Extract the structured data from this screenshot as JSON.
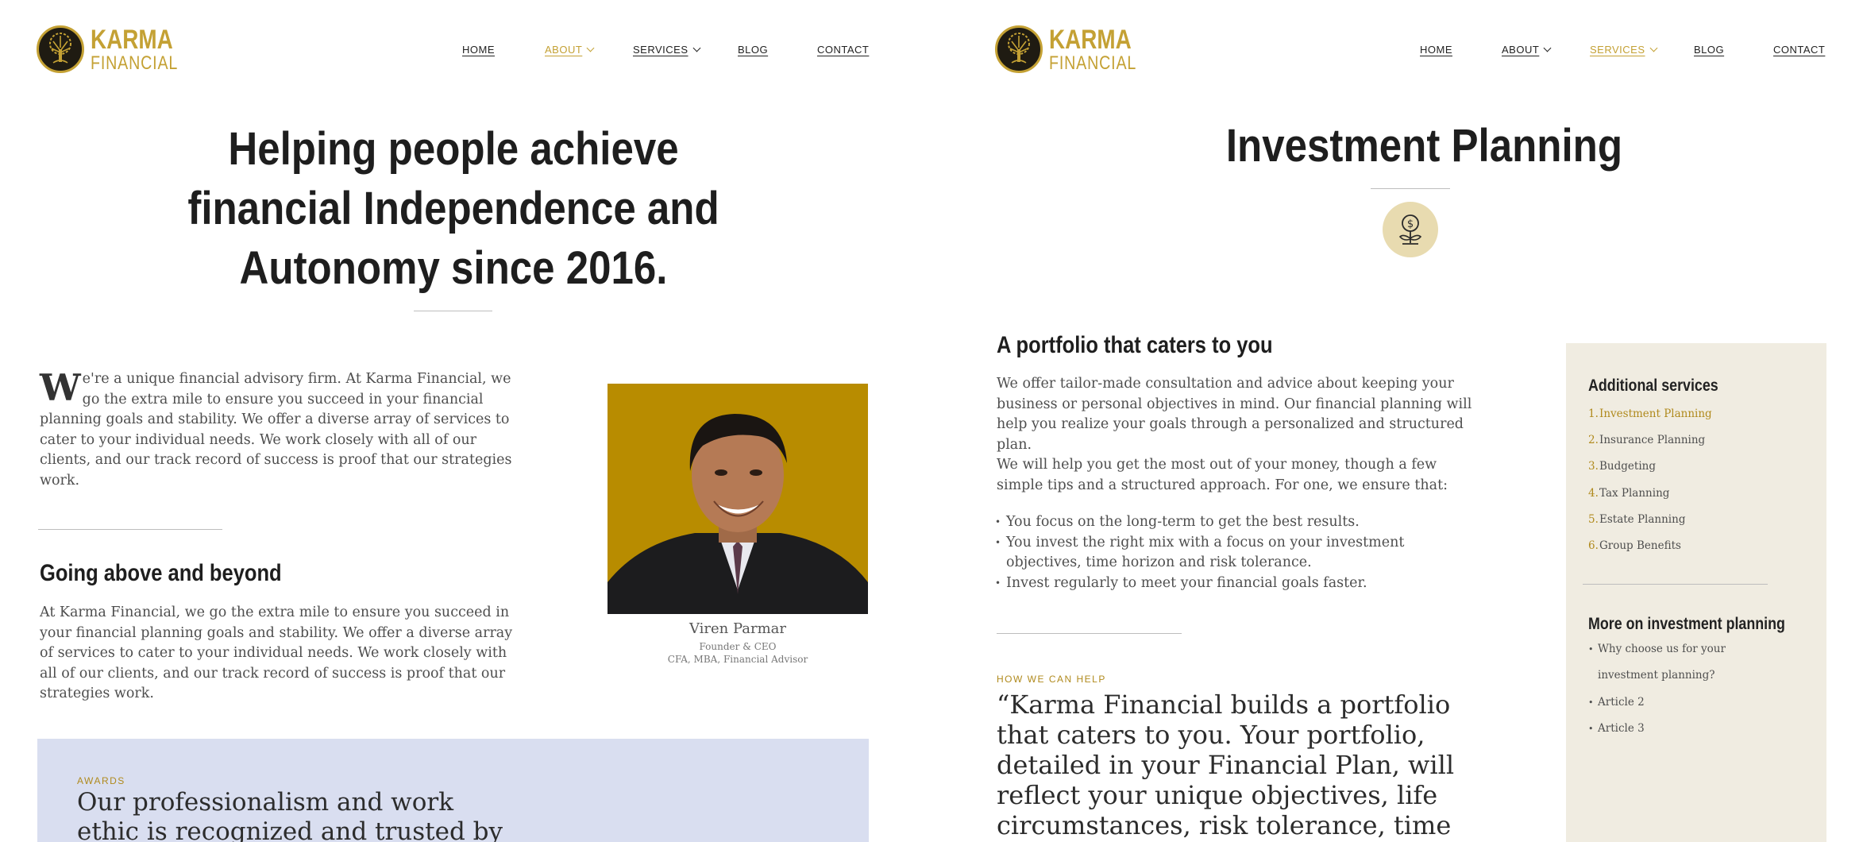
{
  "brand": {
    "line1": "KARMA",
    "line2": "FINANCIAL"
  },
  "colors": {
    "gold": "#c4a134",
    "accent_text": "#b08a1d",
    "awards_bg": "#d9def0",
    "sidebar_bg": "#f0ece1",
    "portrait_bg": "#b88c00"
  },
  "nav": {
    "home": "HOME",
    "about": "ABOUT",
    "services": "SERVICES",
    "blog": "BLOG",
    "contact": "CONTACT"
  },
  "about_page": {
    "active_nav": "ABOUT",
    "hero": [
      "Helping people achieve",
      "financial Independence and",
      "Autonomy since 2016."
    ],
    "intro_dropcap": "W",
    "intro_rest": "e're a unique financial advisory firm. At Karma Financial, we go the extra mile to ensure you succeed in your financial planning goals and stability. We offer a diverse array of services to cater to your individual needs. We work closely with all of our clients, and our track record of success is proof that our strategies work.",
    "section_title": "Going above and beyond",
    "section_body": "At Karma Financial, we go the extra mile to ensure you succeed in your financial planning goals and stability. We offer a diverse array of services to cater to your individual needs. We work closely with all of our clients, and our track record of success is proof that our strategies work.",
    "person": {
      "name": "Viren Parmar",
      "role": "Founder & CEO",
      "credentials": "CFA, MBA, Financial Advisor"
    },
    "awards": {
      "eyebrow": "AWARDS",
      "title": "Our professionalism and work ethic is recognized and trusted by"
    }
  },
  "services_page": {
    "active_nav": "SERVICES",
    "title": "Investment Planning",
    "icon": "money-plant-icon",
    "heading": "A portfolio that caters to you",
    "p1": "We offer tailor-made consultation and advice about keeping your business or personal objectives in mind. Our financial planning will help you realize your goals through a personalized and structured plan.",
    "p2": "We will help you get the most out of your money, though a few simple tips and a structured approach. For one, we ensure that:",
    "bullets": [
      "You focus on the long-term to get the best results.",
      "You invest the right mix with a focus on your investment objectives, time horizon and risk tolerance.",
      "Invest regularly to meet your financial goals faster."
    ],
    "help_eyebrow": "HOW WE CAN HELP",
    "quote": "“Karma Financial builds a portfolio that caters to you. Your portfolio, detailed in your Financial Plan, will reflect your unique objectives, life circumstances, risk tolerance, time horizon, and liquidity",
    "sidebar": {
      "additional_title": "Additional services",
      "services": [
        {
          "num": "1.",
          "label": "Investment Planning"
        },
        {
          "num": "2.",
          "label": "Insurance Planning"
        },
        {
          "num": "3.",
          "label": "Budgeting"
        },
        {
          "num": "4.",
          "label": "Tax Planning"
        },
        {
          "num": "5.",
          "label": "Estate Planning"
        },
        {
          "num": "6.",
          "label": "Group Benefits"
        }
      ],
      "more_title": "More on investment planning",
      "articles": [
        "Why choose us for your investment planning?",
        "Article 2",
        "Article 3"
      ]
    }
  }
}
